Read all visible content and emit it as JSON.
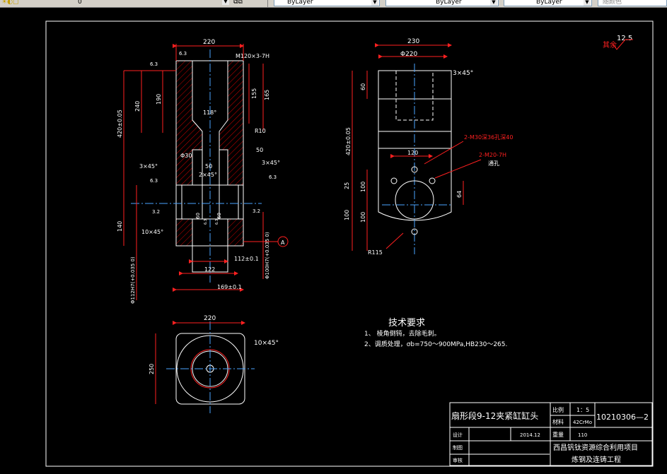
{
  "toolbar": {
    "layer_value": "0",
    "color_combo": "ByLayer",
    "linetype_combo": "ByLayer",
    "lineweight_combo": "ByLayer",
    "plotstyle_combo": "随颜色"
  },
  "drawing": {
    "roughness_general": "12.5",
    "roughness_note": "其余",
    "front_view": {
      "dim_top_width": "220",
      "thread_label": "M120×3-7H",
      "rough_top_left": "6.3",
      "rough_left_upper": "6.3",
      "dim_240": "240",
      "dim_190": "190",
      "dim_155": "155",
      "dim_165": "165",
      "dim_total_height": "420±0.05",
      "angle_118": "118°",
      "r10": "R10",
      "dim_50_right": "50",
      "phi30": "Φ30",
      "dim_50_mid": "50",
      "chamfer_2x45": "2×45°",
      "chamfer_3x45": "3×45°",
      "chamfer_3x45_right": "3×45°",
      "rough_6_3_left": "6.3",
      "rough_6_3_right": "6.3",
      "rough_3_2_left": "3.2",
      "rough_3_2_right": "3.2",
      "dim_140": "140",
      "chamfer_10x45": "10×45°",
      "dim_60a": "60",
      "dim_60b": "60",
      "small_6_3": "6.3",
      "small_6_3b": "6.3",
      "dim_112": "112±0.1",
      "dim_122": "122",
      "dim_169": "169±0.1",
      "phi_left": "Φ112H7(+0.035 0)",
      "phi_right": "Φ100H7(+0.035 0)",
      "datum": "A"
    },
    "side_view": {
      "dim_230": "230",
      "phi220": "Φ220",
      "chamfer_3x45": "3×45°",
      "dim_60": "60",
      "dim_total_height": "420±0.05",
      "hole_note_1": "2-M30深36孔深40",
      "hole_note_2": "2-M20-7H",
      "hole_note_3": "通孔",
      "dim_120": "120",
      "dim_25": "25",
      "dim_100a": "100",
      "dim_64": "64",
      "dim_100b": "100",
      "dim_100c": "100",
      "r115": "R115"
    },
    "top_view": {
      "dim_220": "220",
      "dim_250": "250",
      "chamfer": "10×45°"
    },
    "tech_requirements": {
      "title": "技术要求",
      "line1": "1、 棱角倒钝，去除毛刺。",
      "line2": "2、调质处理，σb=750～900MPa,HB230～265."
    },
    "title_block": {
      "part_name": "扇形段9-12夹紧缸缸头",
      "scale_label": "比例",
      "scale_value": "1：5",
      "material_label": "材料",
      "material_value": "42CrMo",
      "drawing_no": "10210306—2",
      "design_label": "设计",
      "date": "2014.12",
      "weight_label": "重量",
      "weight_value": "110",
      "draw_label": "制图",
      "review_label": "审核",
      "project_line1": "西昌钒钛资源综合利用项目",
      "project_line2": "炼钢及连铸工程"
    }
  }
}
